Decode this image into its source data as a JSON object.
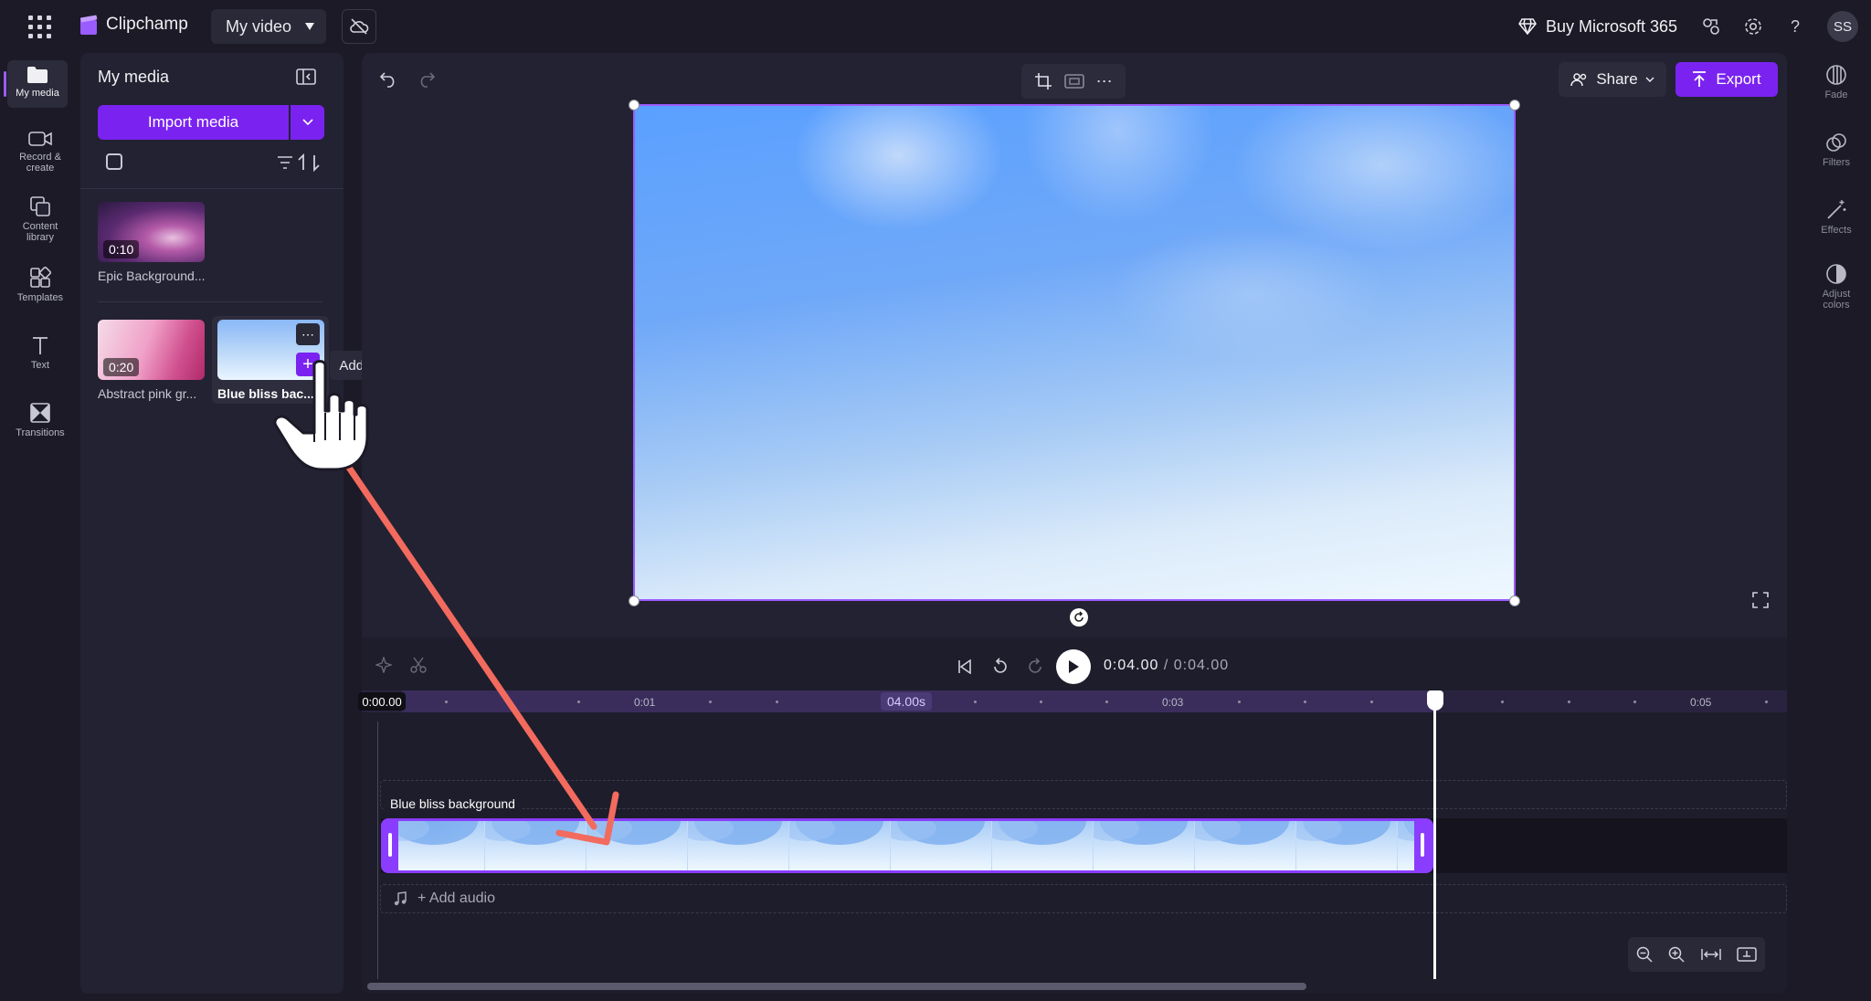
{
  "app": {
    "name": "Clipchamp",
    "project_title": "My video",
    "buy_label": "Buy Microsoft 365",
    "avatar_initials": "SS",
    "accent": "#7a23f0"
  },
  "left_rail": [
    {
      "label": "My media",
      "icon": "folder-icon"
    },
    {
      "label": "Record & create",
      "icon": "camera-icon"
    },
    {
      "label": "Content library",
      "icon": "library-icon"
    },
    {
      "label": "Templates",
      "icon": "templates-icon"
    },
    {
      "label": "Text",
      "icon": "text-icon"
    },
    {
      "label": "Transitions",
      "icon": "transitions-icon"
    }
  ],
  "media_panel": {
    "title": "My media",
    "import_label": "Import media",
    "items": [
      {
        "name": "Epic Background...",
        "duration": "0:10"
      },
      {
        "name": "Abstract pink gr...",
        "duration": "0:20"
      },
      {
        "name": "Blue bliss bac...",
        "duration": ""
      }
    ],
    "tooltip": "Add to timeline"
  },
  "editor": {
    "share_label": "Share",
    "export_label": "Export"
  },
  "right_rail": [
    {
      "label": "Fade",
      "icon": "fade-icon"
    },
    {
      "label": "Filters",
      "icon": "filters-icon"
    },
    {
      "label": "Effects",
      "icon": "effects-icon"
    },
    {
      "label": "Adjust colors",
      "icon": "adjust-colors-icon"
    }
  ],
  "timeline": {
    "current_time": "0:04.00",
    "total_time": "/ 0:04.00",
    "ruler_start": "0:00.00",
    "ruler_current": "04.00s",
    "ticks": [
      "0:01",
      "0:03",
      "0:05"
    ],
    "clip_label": "Blue bliss background",
    "add_audio_label": "+ Add audio"
  }
}
